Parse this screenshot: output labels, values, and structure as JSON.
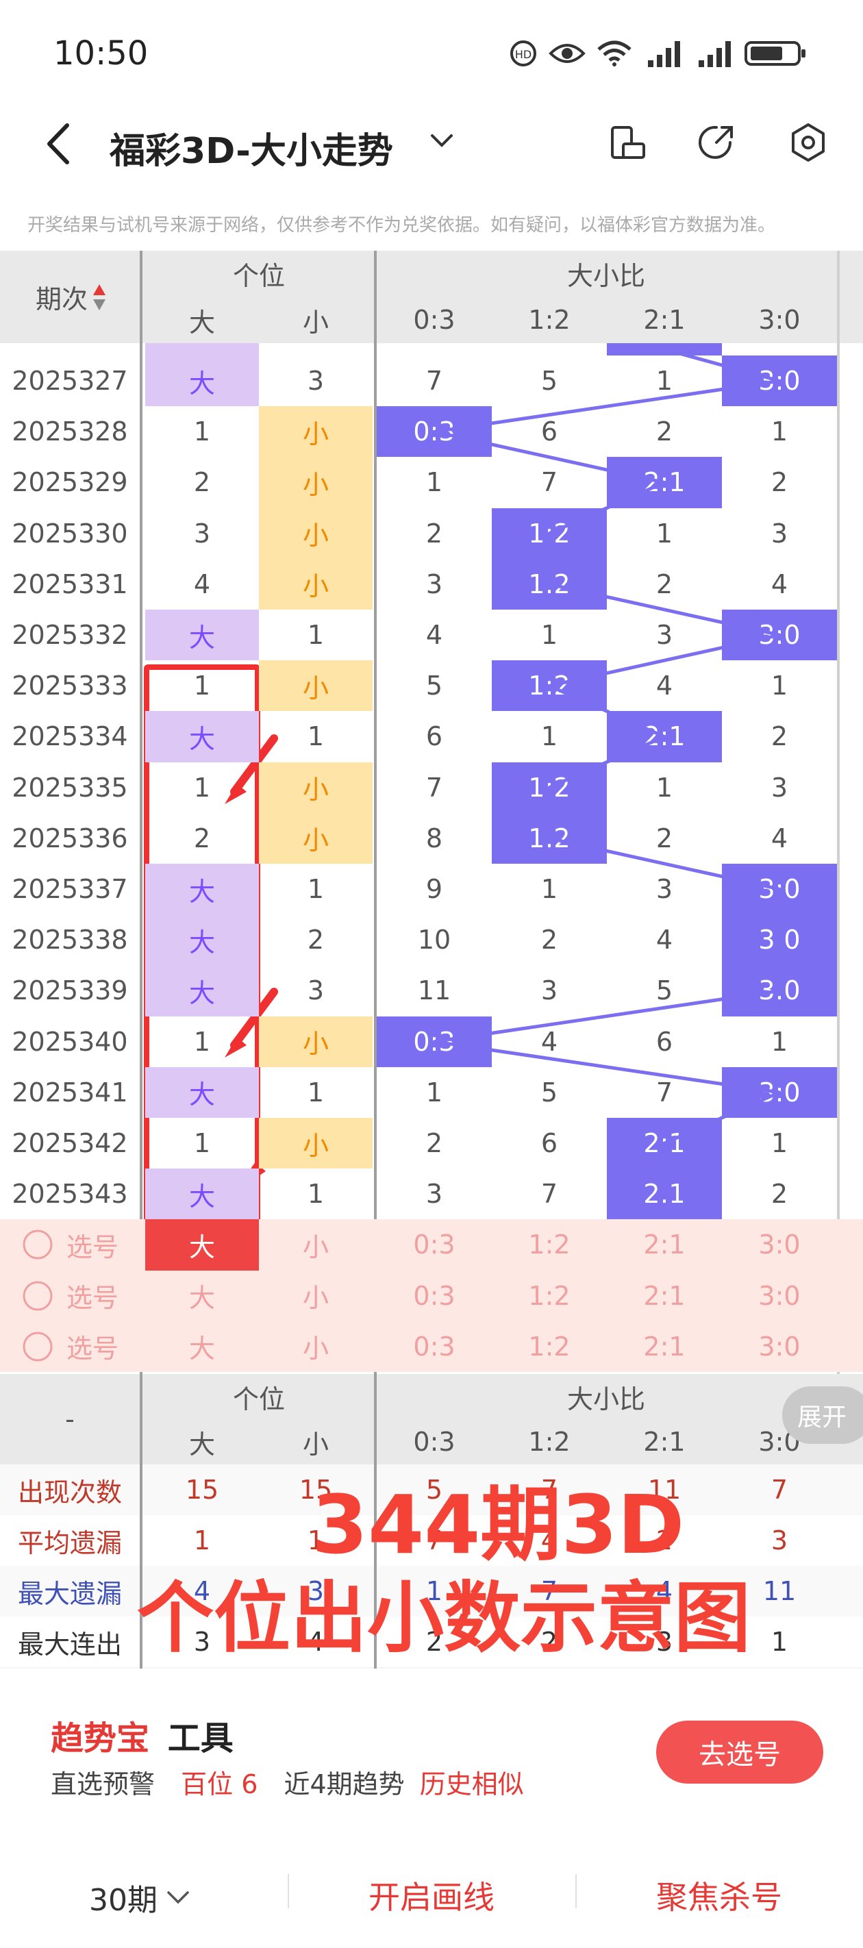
{
  "status": {
    "time": "10:50"
  },
  "header": {
    "title": "福彩3D-大小走势"
  },
  "notice": "开奖结果与试机号来源于网络，仅供参考不作为兑奖依据。如有疑问，以福体彩官方数据为准。",
  "table": {
    "period_header": "期次",
    "group_units": "个位",
    "group_ratio": "大小比",
    "cols": [
      "大",
      "小",
      "0:3",
      "1:2",
      "2:1",
      "3:0"
    ],
    "rows": [
      {
        "p": "2025327",
        "c": [
          "大",
          "3",
          "7",
          "5",
          "1",
          "3:0"
        ],
        "h": [
          0,
          5
        ]
      },
      {
        "p": "2025328",
        "c": [
          "1",
          "小",
          "0:3",
          "6",
          "2",
          "1"
        ],
        "h": [
          1,
          2
        ]
      },
      {
        "p": "2025329",
        "c": [
          "2",
          "小",
          "1",
          "7",
          "2:1",
          "2"
        ],
        "h": [
          1,
          4
        ]
      },
      {
        "p": "2025330",
        "c": [
          "3",
          "小",
          "2",
          "1:2",
          "1",
          "3"
        ],
        "h": [
          1,
          3
        ]
      },
      {
        "p": "2025331",
        "c": [
          "4",
          "小",
          "3",
          "1:2",
          "2",
          "4"
        ],
        "h": [
          1,
          3
        ]
      },
      {
        "p": "2025332",
        "c": [
          "大",
          "1",
          "4",
          "1",
          "3",
          "3:0"
        ],
        "h": [
          0,
          5
        ]
      },
      {
        "p": "2025333",
        "c": [
          "1",
          "小",
          "5",
          "1:2",
          "4",
          "1"
        ],
        "h": [
          1,
          3
        ]
      },
      {
        "p": "2025334",
        "c": [
          "大",
          "1",
          "6",
          "1",
          "2:1",
          "2"
        ],
        "h": [
          0,
          4
        ]
      },
      {
        "p": "2025335",
        "c": [
          "1",
          "小",
          "7",
          "1:2",
          "1",
          "3"
        ],
        "h": [
          1,
          3
        ]
      },
      {
        "p": "2025336",
        "c": [
          "2",
          "小",
          "8",
          "1:2",
          "2",
          "4"
        ],
        "h": [
          1,
          3
        ]
      },
      {
        "p": "2025337",
        "c": [
          "大",
          "1",
          "9",
          "1",
          "3",
          "3:0"
        ],
        "h": [
          0,
          5
        ]
      },
      {
        "p": "2025338",
        "c": [
          "大",
          "2",
          "10",
          "2",
          "4",
          "3:0"
        ],
        "h": [
          0,
          5
        ]
      },
      {
        "p": "2025339",
        "c": [
          "大",
          "3",
          "11",
          "3",
          "5",
          "3:0"
        ],
        "h": [
          0,
          5
        ]
      },
      {
        "p": "2025340",
        "c": [
          "1",
          "小",
          "0:3",
          "4",
          "6",
          "1"
        ],
        "h": [
          1,
          2
        ]
      },
      {
        "p": "2025341",
        "c": [
          "大",
          "1",
          "1",
          "5",
          "7",
          "3:0"
        ],
        "h": [
          0,
          5
        ]
      },
      {
        "p": "2025342",
        "c": [
          "1",
          "小",
          "2",
          "6",
          "2:1",
          "1"
        ],
        "h": [
          1,
          4
        ]
      },
      {
        "p": "2025343",
        "c": [
          "大",
          "1",
          "3",
          "7",
          "2:1",
          "2"
        ],
        "h": [
          0,
          4
        ]
      }
    ],
    "pick_label": "选号",
    "pick_values": [
      "大",
      "小",
      "0:3",
      "1:2",
      "2:1",
      "3:0"
    ],
    "expand_label": "展开",
    "stats_dash": "-",
    "stats": [
      {
        "label": "出现次数",
        "values": [
          "15",
          "15",
          "5",
          "7",
          "11",
          "7"
        ],
        "color": "#c0392b"
      },
      {
        "label": "平均遗漏",
        "values": [
          "1",
          "1",
          "7",
          "4",
          "2",
          "3"
        ],
        "color": "#c0392b"
      },
      {
        "label": "最大遗漏",
        "values": [
          "4",
          "3",
          "1",
          "7",
          "4",
          "11"
        ],
        "color": "#3f51b5"
      },
      {
        "label": "最大连出",
        "values": [
          "3",
          "4",
          "2",
          "2",
          "3",
          "1"
        ],
        "color": "#333333"
      }
    ]
  },
  "overlay": {
    "line1": "344期3D",
    "line2": "个位出小数示意图"
  },
  "tool": {
    "brand": "趋势宝",
    "title": "工具",
    "item1": "直选预警",
    "item1_value": "百位 6",
    "item2": "近4期趋势",
    "item2_value": "历史相似",
    "button": "去选号"
  },
  "bottom": {
    "periods": "30期",
    "draw": "开启画线",
    "focus": "聚焦杀号"
  },
  "colors": {
    "accent": "#f44336",
    "ratio": "#7b6ef0",
    "big": "#dcc7f5",
    "small": "#ffe4a8"
  }
}
